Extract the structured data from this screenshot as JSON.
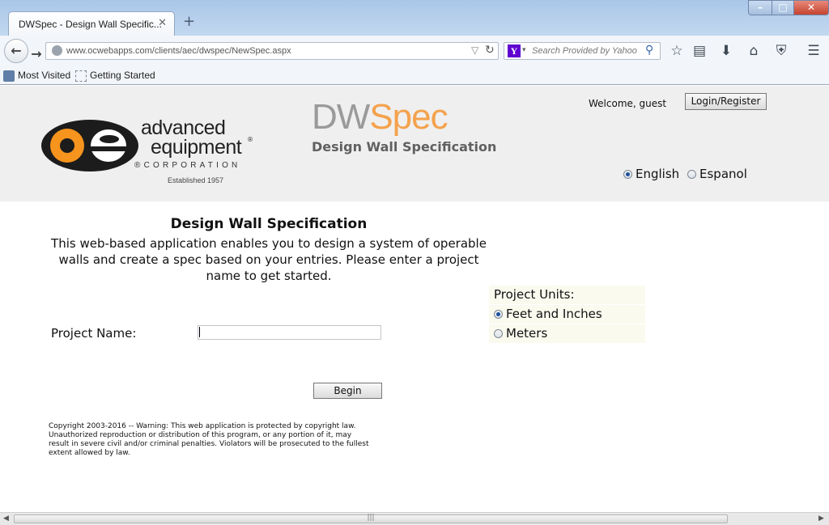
{
  "browser": {
    "tab_title": "DWSpec - Design Wall Specific...",
    "tab_close": "✕",
    "new_tab": "+",
    "url": "www.ocwebapps.com/clients/aec/dwspec/NewSpec.aspx",
    "search_placeholder": "Search Provided by Yahoo",
    "search_engine_logo": "Y",
    "bookmarks": [
      "Most Visited",
      "Getting Started"
    ]
  },
  "header": {
    "logo_line1": "advanced",
    "logo_line2": "equipment",
    "logo_reg": "®",
    "logo_corp": "®CORPORATION",
    "logo_established": "Established 1957",
    "brand_dw": "DW",
    "brand_spec": "Spec",
    "brand_subtitle": "Design Wall Specification",
    "welcome": "Welcome, guest",
    "login_button": "Login/Register",
    "languages": [
      {
        "label": "English",
        "selected": true
      },
      {
        "label": "Espanol",
        "selected": false
      }
    ]
  },
  "main": {
    "title": "Design Wall Specification",
    "description": "This web-based application enables you to design a system of operable walls and create a spec based on your entries. Please enter a project name to get started.",
    "project_name_label": "Project Name:",
    "project_name_value": "",
    "units_label": "Project Units:",
    "units": [
      {
        "label": "Feet and Inches",
        "selected": true
      },
      {
        "label": "Meters",
        "selected": false
      }
    ],
    "begin_button": "Begin",
    "copyright": "Copyright 2003-2016 -- Warning: This web application is protected by copyright law. Unauthorized reproduction or distribution of this program, or any portion of it, may result in severe civil and/or criminal penalties. Violators will be prosecuted to the fullest extent allowed by law."
  },
  "colors": {
    "brand_orange": "#f4a24d",
    "brand_gray": "#9a9a9a",
    "header_bg": "#efefef",
    "units_bg": "#fbfaef"
  },
  "icons": {
    "back": "back-arrow-icon",
    "forward": "forward-arrow-icon",
    "reload": "reload-icon",
    "bookmark_star": "star-icon",
    "reading_list": "clipboard-icon",
    "downloads": "download-icon",
    "home": "home-icon",
    "shield": "shield-icon",
    "menu": "hamburger-menu-icon"
  }
}
